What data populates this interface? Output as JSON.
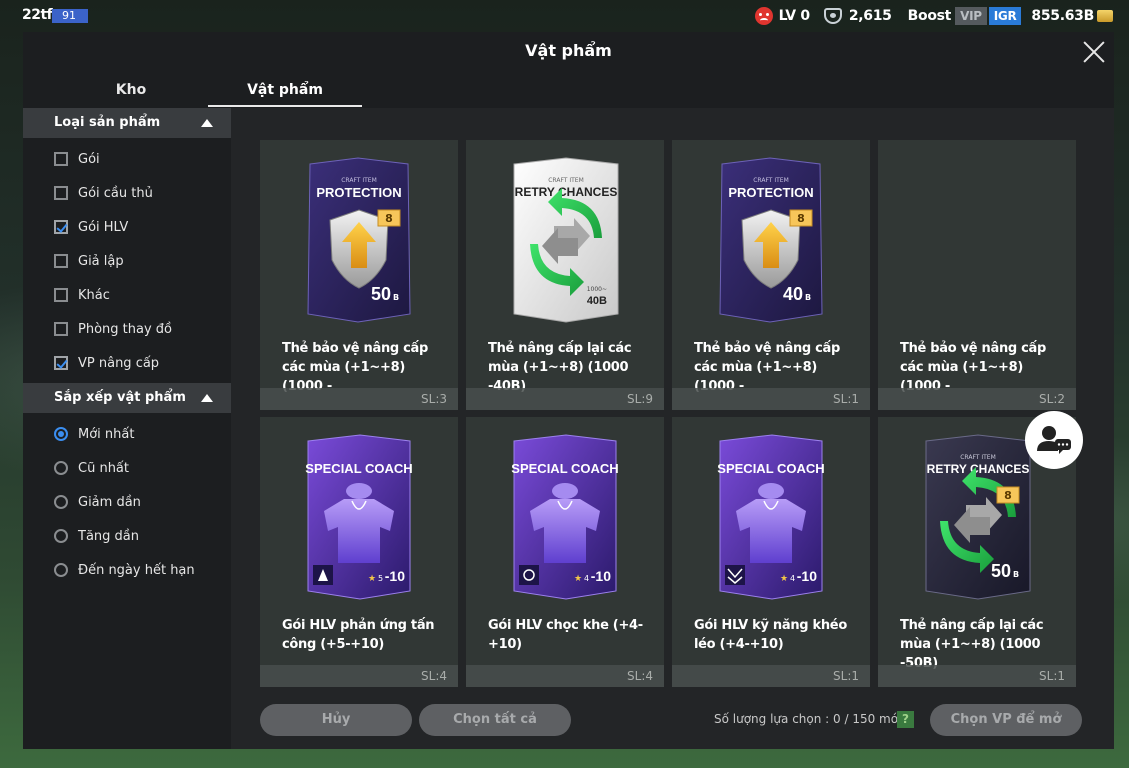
{
  "topbar": {
    "team_name": "22tf",
    "team_ovr": "91",
    "level": "LV 0",
    "coins": "2,615",
    "boost": "Boost",
    "vip": "VIP",
    "igr": "IGR",
    "money": "855.63B"
  },
  "modal": {
    "title": "Vật phẩm",
    "tabs": [
      "Kho",
      "Vật phẩm"
    ],
    "active_tab": "Vật phẩm"
  },
  "filters": {
    "product_type_label": "Loại sản phẩm",
    "product_types": [
      {
        "label": "Gói",
        "checked": false
      },
      {
        "label": "Gói cầu thủ",
        "checked": false
      },
      {
        "label": "Gói HLV",
        "checked": true
      },
      {
        "label": "Giả lập",
        "checked": false
      },
      {
        "label": "Khác",
        "checked": false
      },
      {
        "label": "Phòng thay đồ",
        "checked": false
      },
      {
        "label": "VP nâng cấp",
        "checked": true
      }
    ],
    "sort_label": "Sắp xếp vật phẩm",
    "sort_options": [
      {
        "label": "Mới nhất",
        "selected": true
      },
      {
        "label": "Cũ nhất",
        "selected": false
      },
      {
        "label": "Giảm dần",
        "selected": false
      },
      {
        "label": "Tăng dần",
        "selected": false
      },
      {
        "label": "Đến ngày hết hạn",
        "selected": false
      }
    ]
  },
  "items": [
    {
      "kind": "protection",
      "top": "CRAFT ITEM",
      "title": "PROTECTION",
      "badge": "8",
      "value": "50",
      "unit": "B",
      "name": "Thẻ bảo vệ nâng cấp các mùa (+1~+8) (1000 -",
      "count": "SL:3"
    },
    {
      "kind": "retry-white",
      "top": "CRAFT ITEM",
      "title": "RETRY CHANCES",
      "sub": "1000~",
      "value": "40B",
      "name": "Thẻ nâng cấp lại các mùa (+1~+8) (1000 -40B)",
      "count": "SL:9"
    },
    {
      "kind": "protection",
      "top": "CRAFT ITEM",
      "title": "PROTECTION",
      "badge": "8",
      "value": "40",
      "unit": "B",
      "name": "Thẻ bảo vệ nâng cấp các mùa (+1~+8) (1000 -",
      "count": "SL:1"
    },
    {
      "kind": "empty",
      "name": "Thẻ bảo vệ nâng cấp các mùa (+1~+8)(1000 -",
      "count": "SL:2"
    },
    {
      "kind": "coach",
      "title": "SPECIAL COACH",
      "grade": "5",
      "range": "-10",
      "name": "Gói HLV phản ứng tấn công (+5-+10)",
      "count": "SL:4"
    },
    {
      "kind": "coach",
      "title": "SPECIAL COACH",
      "grade": "4",
      "range": "-10",
      "name": "Gói HLV chọc khe (+4-+10)",
      "count": "SL:4"
    },
    {
      "kind": "coach",
      "title": "SPECIAL COACH",
      "grade": "4",
      "range": "-10",
      "name": "Gói HLV kỹ năng khéo léo (+4-+10)",
      "count": "SL:1"
    },
    {
      "kind": "retry-dark",
      "top": "CRAFT ITEM",
      "title": "RETRY CHANCES",
      "badge": "8",
      "value": "50",
      "unit": "B",
      "name": "Thẻ nâng cấp lại các mùa (+1~+8) (1000 -50B)",
      "count": "SL:1"
    }
  ],
  "bottom": {
    "cancel": "Hủy",
    "select_all": "Chọn tất cả",
    "count_text": "Số lượng lựa chọn : 0 / 150 món",
    "help": "?",
    "open": "Chọn VP để mở"
  },
  "colors": {
    "accent_blue": "#3b8ef0",
    "card_purple": "#4b2f9c",
    "gold": "#e6b84a"
  }
}
